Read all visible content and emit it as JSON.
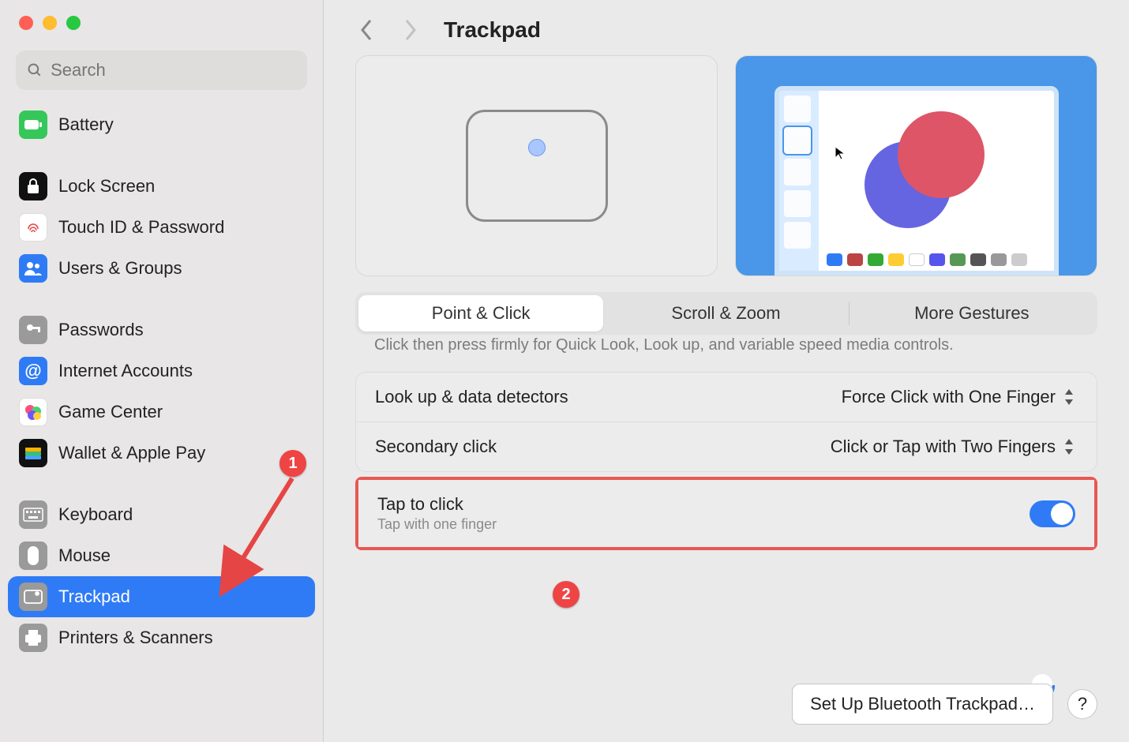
{
  "header": {
    "title": "Trackpad"
  },
  "search": {
    "placeholder": "Search"
  },
  "sidebar": {
    "groups": [
      {
        "items": [
          {
            "label": "Battery",
            "icon": "battery",
            "bg": "#35c759"
          }
        ]
      },
      {
        "items": [
          {
            "label": "Lock Screen",
            "icon": "lock",
            "bg": "#111"
          },
          {
            "label": "Touch ID & Password",
            "icon": "fingerprint",
            "bg": "#ffffff"
          },
          {
            "label": "Users & Groups",
            "icon": "users",
            "bg": "#2f7bf6"
          }
        ]
      },
      {
        "items": [
          {
            "label": "Passwords",
            "icon": "key",
            "bg": "#9a9a9a"
          },
          {
            "label": "Internet Accounts",
            "icon": "at",
            "bg": "#2f7bf6"
          },
          {
            "label": "Game Center",
            "icon": "gamecenter",
            "bg": "#ffffff"
          },
          {
            "label": "Wallet & Apple Pay",
            "icon": "wallet",
            "bg": "#111"
          }
        ]
      },
      {
        "items": [
          {
            "label": "Keyboard",
            "icon": "keyboard",
            "bg": "#9a9a9a"
          },
          {
            "label": "Mouse",
            "icon": "mouse",
            "bg": "#9a9a9a"
          },
          {
            "label": "Trackpad",
            "icon": "trackpad",
            "bg": "#2f7bf6",
            "selected": true
          },
          {
            "label": "Printers & Scanners",
            "icon": "printer",
            "bg": "#9a9a9a"
          }
        ]
      }
    ]
  },
  "tabs": [
    {
      "label": "Point & Click",
      "active": true
    },
    {
      "label": "Scroll & Zoom"
    },
    {
      "label": "More Gestures"
    }
  ],
  "settings": {
    "force_click_desc": "Click then press firmly for Quick Look, Look up, and variable speed media controls.",
    "lookup": {
      "label": "Look up & data detectors",
      "value": "Force Click with One Finger"
    },
    "secondary": {
      "label": "Secondary click",
      "value": "Click or Tap with Two Fingers"
    },
    "tap": {
      "label": "Tap to click",
      "sub": "Tap with one finger",
      "on": true
    }
  },
  "footer": {
    "setup_btn": "Set Up Bluetooth Trackpad…",
    "help": "?"
  },
  "annotations": {
    "callout1": "1",
    "callout2": "2"
  }
}
